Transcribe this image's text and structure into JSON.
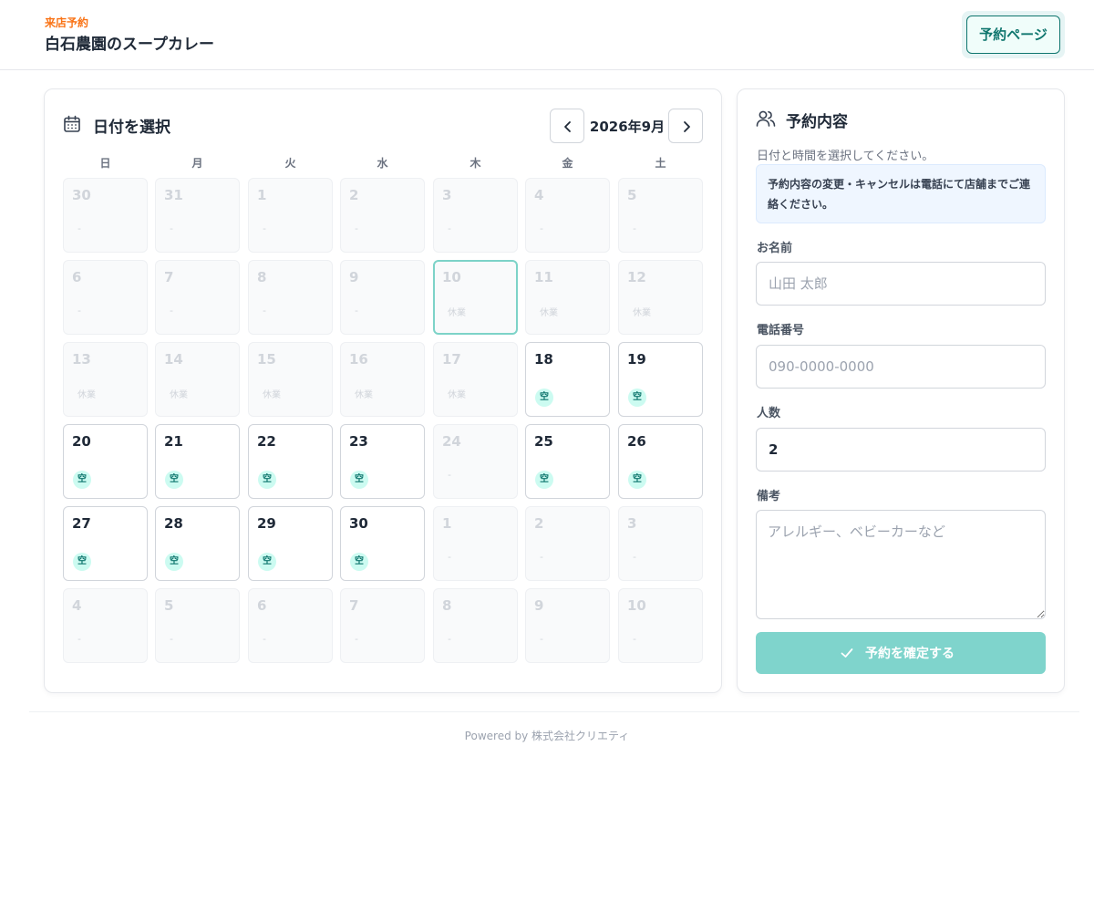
{
  "header": {
    "kicker": "来店予約",
    "title": "白石農園のスープカレー",
    "page_button": "予約ページ"
  },
  "calendar": {
    "title": "日付を選択",
    "month_label": "2026年9月",
    "weekdays": [
      "日",
      "月",
      "火",
      "水",
      "木",
      "金",
      "土"
    ],
    "available_label": "空",
    "closed_label": "休業",
    "none_label": "-",
    "weeks": [
      [
        {
          "day": "30",
          "status": "none"
        },
        {
          "day": "31",
          "status": "none"
        },
        {
          "day": "1",
          "status": "none"
        },
        {
          "day": "2",
          "status": "none"
        },
        {
          "day": "3",
          "status": "none"
        },
        {
          "day": "4",
          "status": "none"
        },
        {
          "day": "5",
          "status": "none"
        }
      ],
      [
        {
          "day": "6",
          "status": "none"
        },
        {
          "day": "7",
          "status": "none"
        },
        {
          "day": "8",
          "status": "none"
        },
        {
          "day": "9",
          "status": "none"
        },
        {
          "day": "10",
          "status": "closed",
          "selected": true
        },
        {
          "day": "11",
          "status": "closed"
        },
        {
          "day": "12",
          "status": "closed"
        }
      ],
      [
        {
          "day": "13",
          "status": "closed"
        },
        {
          "day": "14",
          "status": "closed"
        },
        {
          "day": "15",
          "status": "closed"
        },
        {
          "day": "16",
          "status": "closed"
        },
        {
          "day": "17",
          "status": "closed"
        },
        {
          "day": "18",
          "status": "available"
        },
        {
          "day": "19",
          "status": "available"
        }
      ],
      [
        {
          "day": "20",
          "status": "available"
        },
        {
          "day": "21",
          "status": "available"
        },
        {
          "day": "22",
          "status": "available"
        },
        {
          "day": "23",
          "status": "available"
        },
        {
          "day": "24",
          "status": "none"
        },
        {
          "day": "25",
          "status": "available"
        },
        {
          "day": "26",
          "status": "available"
        }
      ],
      [
        {
          "day": "27",
          "status": "available"
        },
        {
          "day": "28",
          "status": "available"
        },
        {
          "day": "29",
          "status": "available"
        },
        {
          "day": "30",
          "status": "available"
        },
        {
          "day": "1",
          "status": "none"
        },
        {
          "day": "2",
          "status": "none"
        },
        {
          "day": "3",
          "status": "none"
        }
      ],
      [
        {
          "day": "4",
          "status": "none"
        },
        {
          "day": "5",
          "status": "none"
        },
        {
          "day": "6",
          "status": "none"
        },
        {
          "day": "7",
          "status": "none"
        },
        {
          "day": "8",
          "status": "none"
        },
        {
          "day": "9",
          "status": "none"
        },
        {
          "day": "10",
          "status": "none"
        }
      ]
    ]
  },
  "form": {
    "title": "予約内容",
    "hint": "日付と時間を選択してください。",
    "notice": "予約内容の変更・キャンセルは電話にて店舗までご連絡ください。",
    "name_label": "お名前",
    "name_placeholder": "山田 太郎",
    "phone_label": "電話番号",
    "phone_placeholder": "090-0000-0000",
    "party_label": "人数",
    "party_value": "2",
    "notes_label": "備考",
    "notes_placeholder": "アレルギー、ベビーカーなど",
    "submit_label": "予約を確定する"
  },
  "footer": {
    "text": "Powered by 株式会社クリエティ"
  },
  "colors": {
    "accent": "#0f766e",
    "accent_soft": "#ccfbf1",
    "kicker": "#f97316",
    "submit_bg": "#7fd4cc",
    "selected_border": "#7dd3c8"
  }
}
